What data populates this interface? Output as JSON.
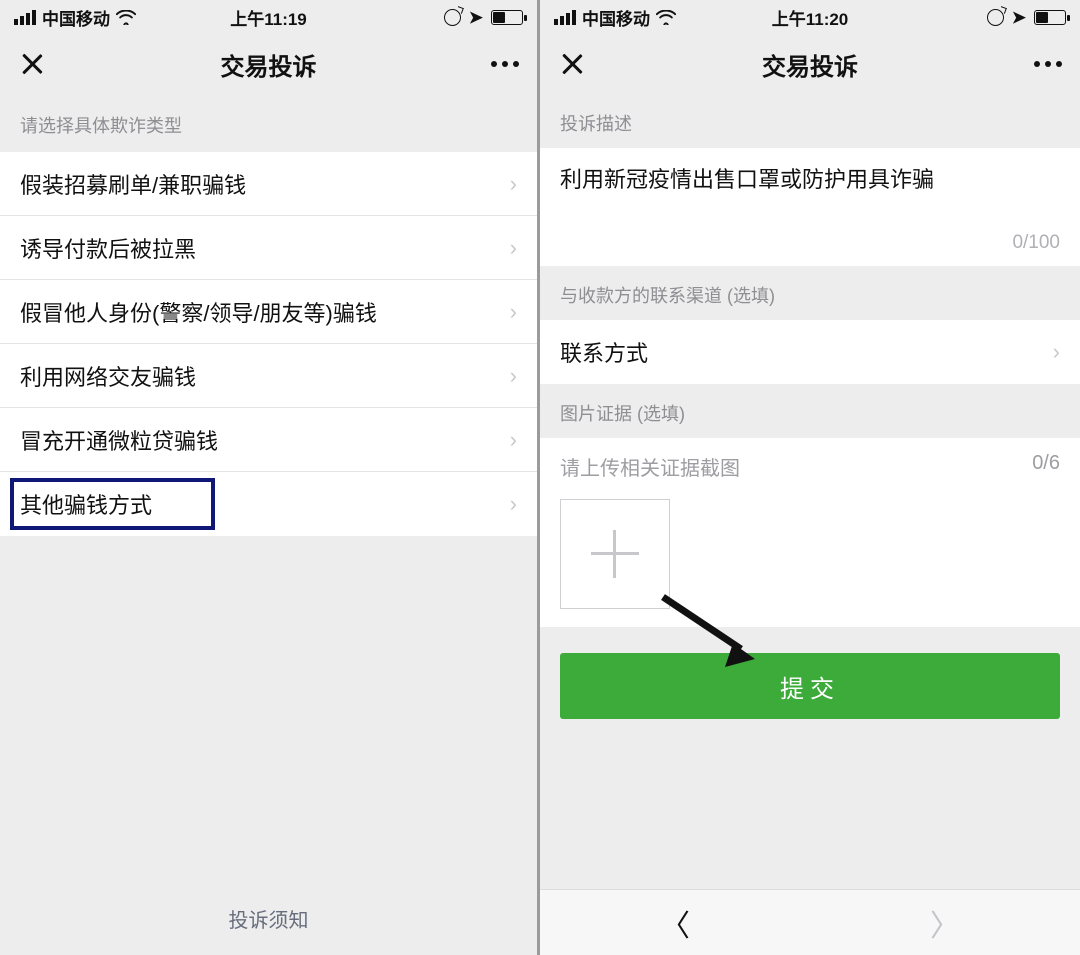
{
  "left": {
    "status": {
      "carrier": "中国移动",
      "time": "上午11:19"
    },
    "nav": {
      "title": "交易投诉"
    },
    "section_label": "请选择具体欺诈类型",
    "rows": [
      "假装招募刷单/兼职骗钱",
      "诱导付款后被拉黑",
      "假冒他人身份(警察/领导/朋友等)骗钱",
      "利用网络交友骗钱",
      "冒充开通微粒贷骗钱",
      "其他骗钱方式"
    ],
    "footer": "投诉须知"
  },
  "right": {
    "status": {
      "carrier": "中国移动",
      "time": "上午11:20"
    },
    "nav": {
      "title": "交易投诉"
    },
    "desc_label": "投诉描述",
    "desc_text": "利用新冠疫情出售口罩或防护用具诈骗",
    "desc_counter": "0/100",
    "contact_label": "与收款方的联系渠道 (选填)",
    "contact_row": "联系方式",
    "image_label": "图片证据 (选填)",
    "upload_hint": "请上传相关证据截图",
    "upload_counter": "0/6",
    "submit": "提交"
  }
}
